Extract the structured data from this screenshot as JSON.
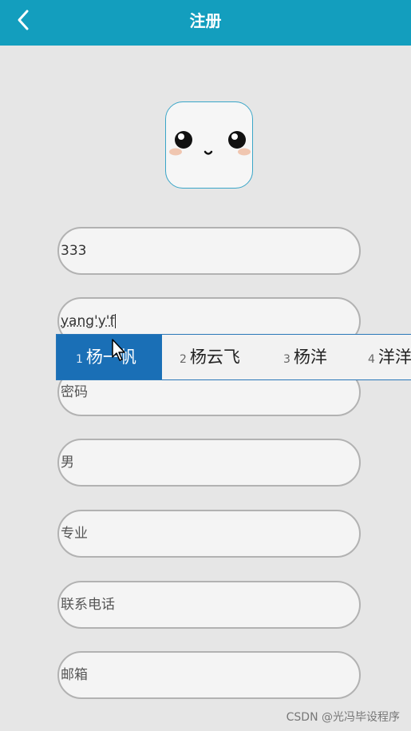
{
  "header": {
    "title": "注册",
    "back_icon": "chevron-left-icon",
    "color": "#139ebe"
  },
  "avatar": {
    "icon": "smiley-face-icon"
  },
  "form": {
    "account": {
      "value": "333"
    },
    "name": {
      "composing": "yang'y'f"
    },
    "password": {
      "placeholder": "密码"
    },
    "gender": {
      "placeholder": "男"
    },
    "major": {
      "placeholder": "专业"
    },
    "phone": {
      "placeholder": "联系电话"
    },
    "email": {
      "placeholder": "邮箱"
    }
  },
  "ime": {
    "candidates": [
      {
        "num": "1",
        "text": "杨一帆",
        "selected": true
      },
      {
        "num": "2",
        "text": "杨云飞",
        "selected": false
      },
      {
        "num": "3",
        "text": "杨洋",
        "selected": false
      },
      {
        "num": "4",
        "text": "洋洋",
        "selected": false
      }
    ],
    "highlight_color": "#1a6fb6"
  },
  "watermark": "CSDN @光冯毕设程序"
}
